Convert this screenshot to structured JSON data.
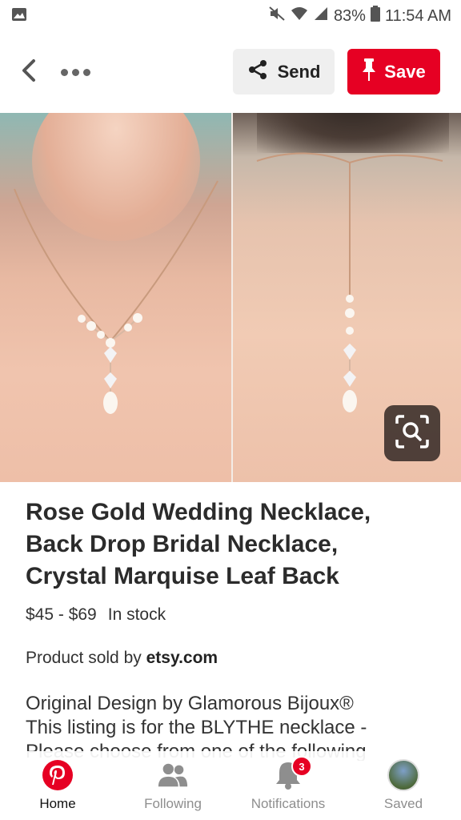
{
  "status_bar": {
    "battery": "83%",
    "time": "11:54 AM",
    "icons": [
      "image-icon",
      "mute-icon",
      "wifi-icon",
      "signal-icon",
      "battery-icon"
    ]
  },
  "header": {
    "send_label": "Send",
    "save_label": "Save",
    "icons": [
      "back-icon",
      "more-icon",
      "share-icon",
      "pin-icon"
    ]
  },
  "image": {
    "visual_search_icon": "lens-icon"
  },
  "product": {
    "title_line1": "Rose Gold Wedding Necklace,",
    "title_line2": "Back Drop Bridal Necklace,",
    "title_line3": "Crystal Marquise Leaf Back",
    "price": "$45 - $69",
    "stock": "In stock",
    "seller_prefix": "Product sold by",
    "seller": "etsy.com",
    "desc_line1": "Original Design by Glamorous Bijoux®",
    "desc_line2": "This listing is for the BLYTHE necklace -",
    "desc_line3": "Please choose from one of the following"
  },
  "nav": {
    "home": "Home",
    "following": "Following",
    "notifications": "Notifications",
    "notifications_badge": "3",
    "saved": "Saved"
  },
  "colors": {
    "brand_red": "#e60023",
    "send_bg": "#efefef"
  }
}
